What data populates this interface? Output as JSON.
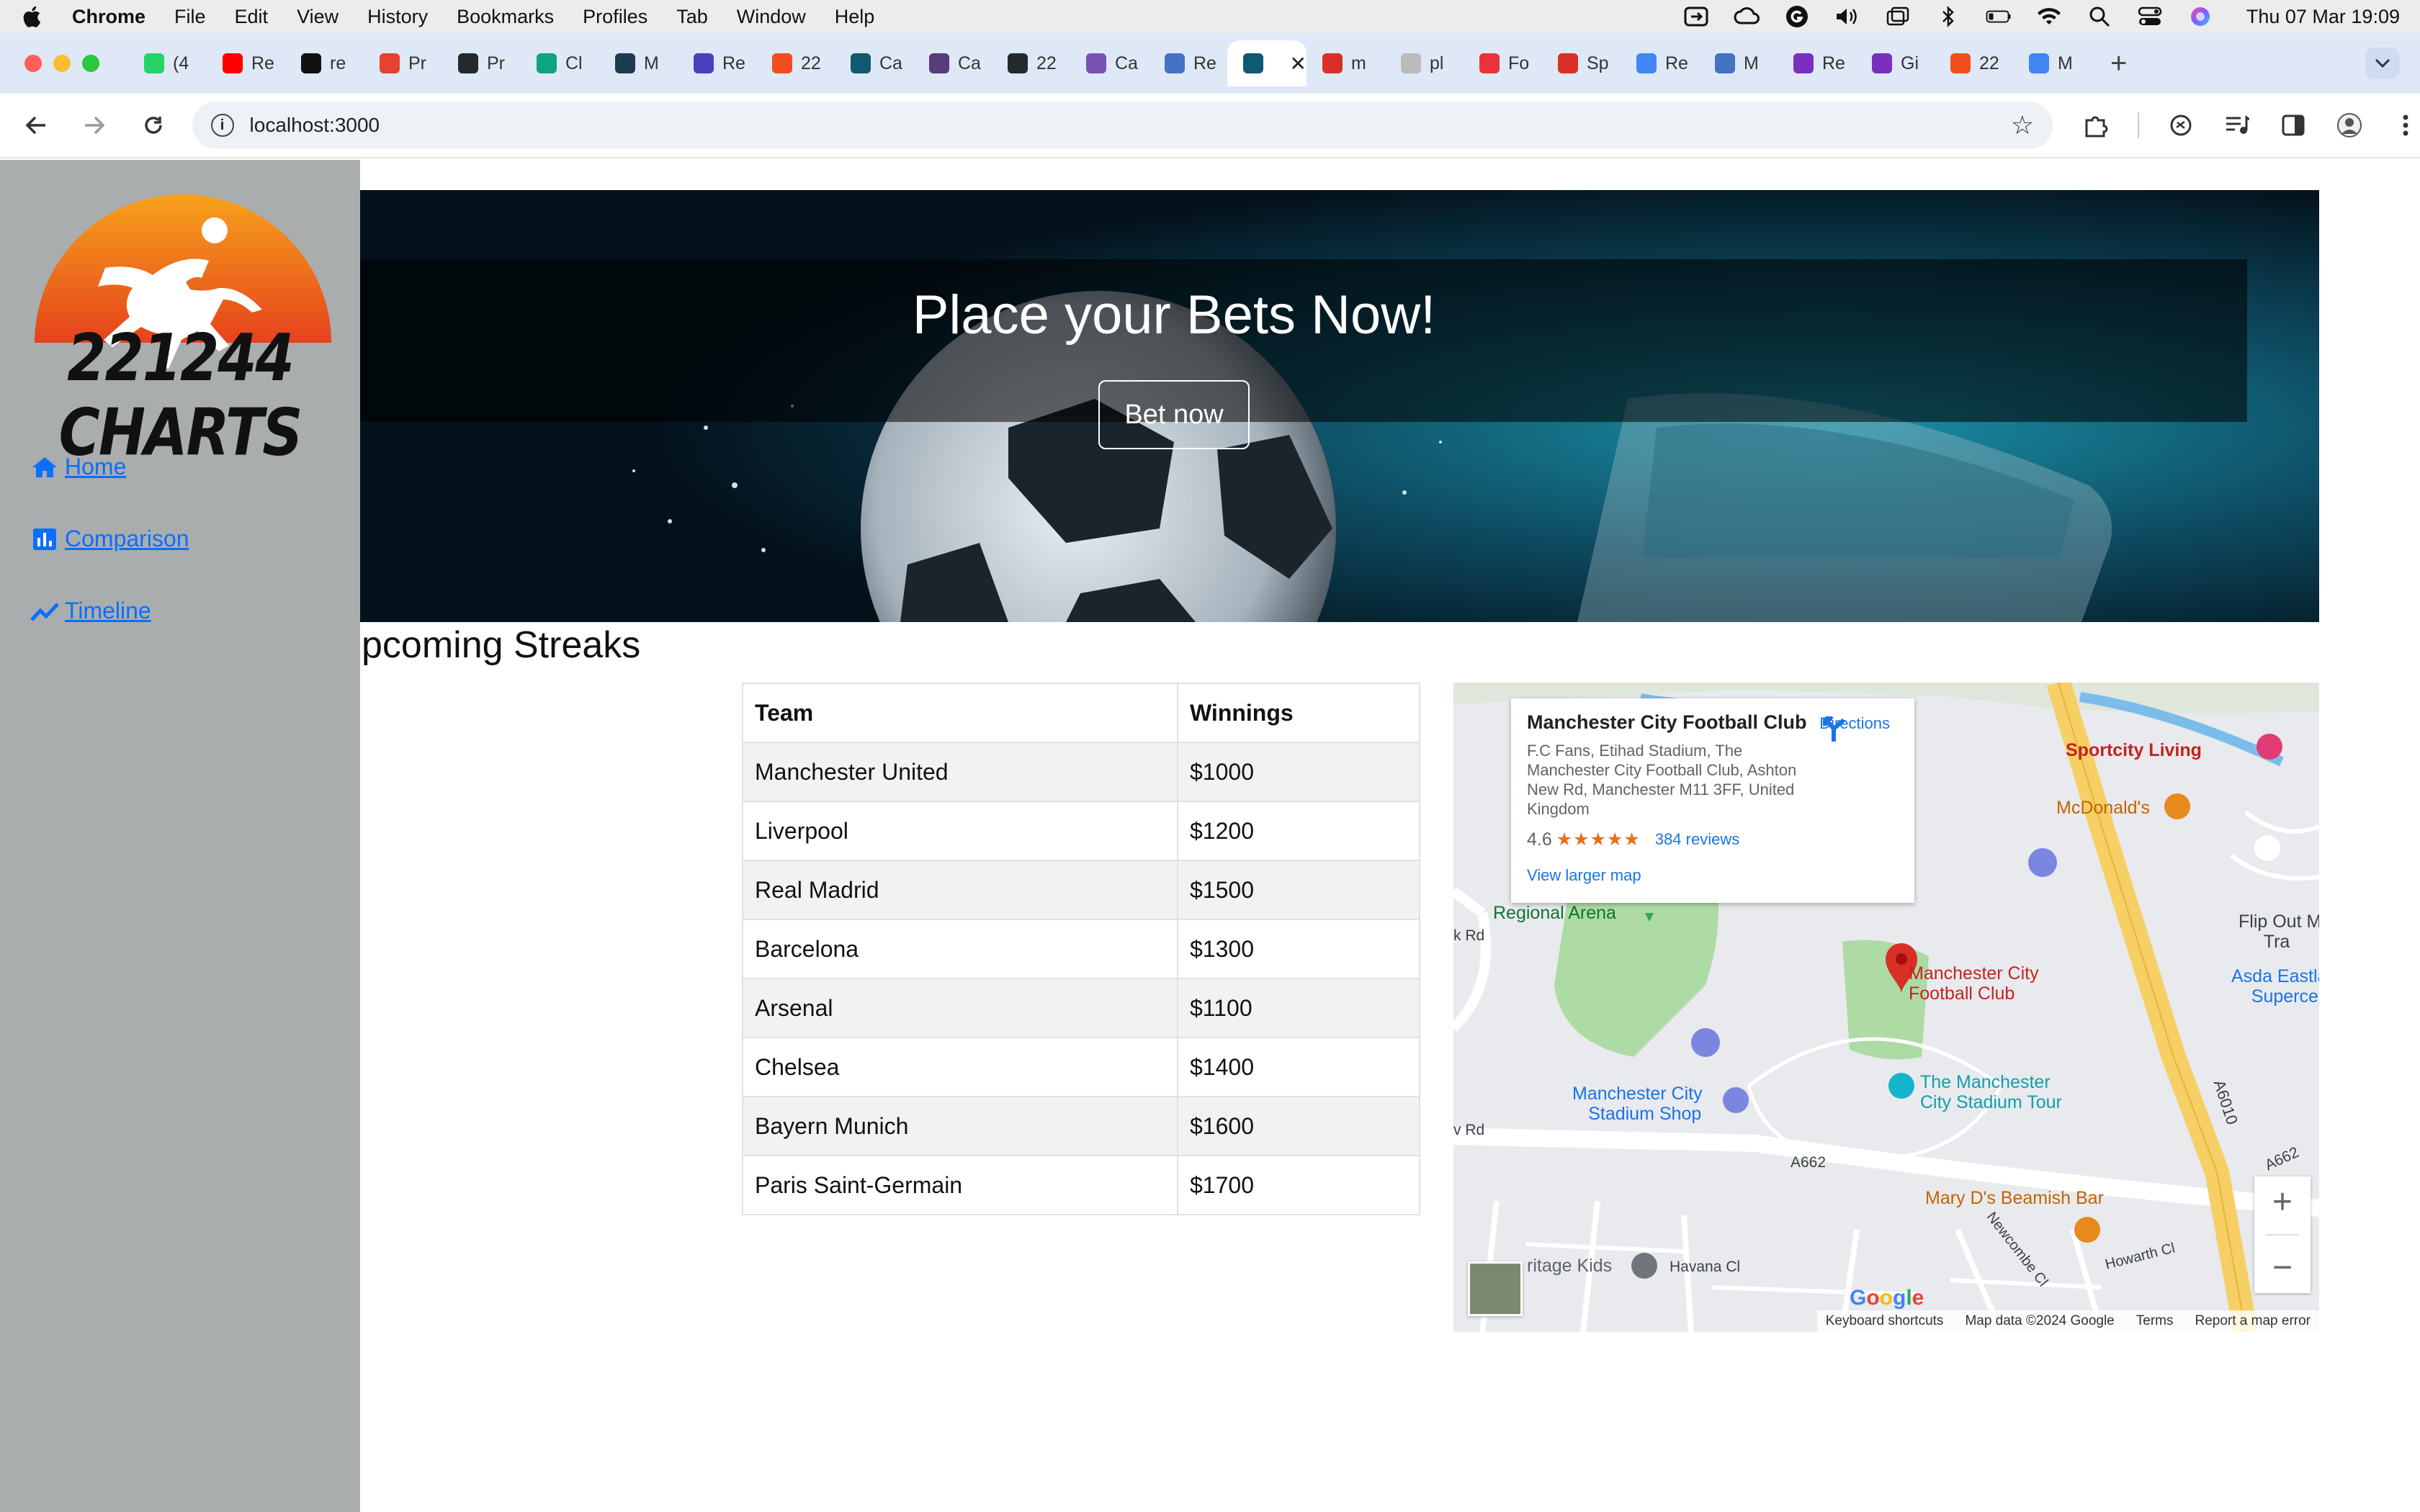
{
  "os_menubar": {
    "app_name": "Chrome",
    "menus": [
      "File",
      "Edit",
      "View",
      "History",
      "Bookmarks",
      "Profiles",
      "Tab",
      "Window",
      "Help"
    ],
    "clock": "Thu 07 Mar  19:09"
  },
  "browser": {
    "tabs": [
      {
        "label": "(4",
        "color": "#25d366"
      },
      {
        "label": "Re",
        "color": "#ff0000"
      },
      {
        "label": "re",
        "color": "#111111"
      },
      {
        "label": "Pr",
        "color": "#e44332"
      },
      {
        "label": "Pr",
        "color": "#24292f"
      },
      {
        "label": "Cl",
        "color": "#10a37f"
      },
      {
        "label": "M",
        "color": "#1d3b4f"
      },
      {
        "label": "Re",
        "color": "#4b3fbf"
      },
      {
        "label": "22",
        "color": "#f24e1e"
      },
      {
        "label": "Ca",
        "color": "#0e5a6e"
      },
      {
        "label": "Ca",
        "color": "#563d7c"
      },
      {
        "label": "22",
        "color": "#24292f"
      },
      {
        "label": "Ca",
        "color": "#7952b3"
      },
      {
        "label": "Re",
        "color": "#4472c4"
      },
      {
        "label": "",
        "color": "#0e5a6e",
        "active": true
      },
      {
        "label": "m",
        "color": "#d93025"
      },
      {
        "label": "pl",
        "color": "#bbbbbb"
      },
      {
        "label": "Fo",
        "color": "#e8323c"
      },
      {
        "label": "Sp",
        "color": "#d93025"
      },
      {
        "label": "Re",
        "color": "#4285f4"
      },
      {
        "label": "M",
        "color": "#4472c4"
      },
      {
        "label": "Re",
        "color": "#7b2fbe"
      },
      {
        "label": "Gi",
        "color": "#7b2fbe"
      },
      {
        "label": "22",
        "color": "#f24e1e"
      },
      {
        "label": "M",
        "color": "#4285f4"
      }
    ],
    "url": "localhost:3000"
  },
  "sidebar": {
    "logo_text": "221244 CHARTS",
    "nav": [
      {
        "label": "Home",
        "icon": "home-icon"
      },
      {
        "label": "Comparison",
        "icon": "bar-chart-icon"
      },
      {
        "label": "Timeline",
        "icon": "trend-line-icon"
      }
    ]
  },
  "hero": {
    "title": "Place your Bets Now!",
    "button_label": "Bet now"
  },
  "section_title": "pcoming Streaks",
  "table": {
    "headers": [
      "Team",
      "Winnings"
    ],
    "rows": [
      [
        "Manchester United",
        "$1000"
      ],
      [
        "Liverpool",
        "$1200"
      ],
      [
        "Real Madrid",
        "$1500"
      ],
      [
        "Barcelona",
        "$1300"
      ],
      [
        "Arsenal",
        "$1100"
      ],
      [
        "Chelsea",
        "$1400"
      ],
      [
        "Bayern Munich",
        "$1600"
      ],
      [
        "Paris Saint-Germain",
        "$1700"
      ]
    ]
  },
  "map": {
    "place_title": "Manchester City Football Club",
    "address": "F.C Fans, Etihad Stadium, The Manchester City Football Club, Ashton New Rd, Manchester M11 3FF, United Kingdom",
    "rating": "4.6",
    "reviews": "384 reviews",
    "view_larger": "View larger map",
    "directions": "Directions",
    "labels": {
      "sportcity": "Sportcity Living",
      "mcdonalds": "McDonald's",
      "regional_arena": "Regional Arena",
      "club_marker_line1": "Manchester City",
      "club_marker_line2": "Football Club",
      "flipout": "Flip Out M",
      "flipout2": "Tra",
      "asda": "Asda Eastla",
      "asda2": "Superce",
      "stadium_shop_line1": "Manchester City",
      "stadium_shop_line2": "Stadium Shop",
      "tour_line1": "The Manchester",
      "tour_line2": "City Stadium Tour",
      "a662": "A662",
      "a662b": "A662",
      "a6010": "A6010",
      "marys": "Mary D's Beamish Bar",
      "heritage": "ritage Kids",
      "havana": "Havana Cl",
      "newcombe": "Newcombe Cl",
      "howarth": "Howarth Cl",
      "rd_left": "k Rd",
      "rd_left2": "v Rd"
    },
    "footer": [
      "Keyboard shortcuts",
      "Map data ©2024 Google",
      "Terms",
      "Report a map error"
    ],
    "google_letters": [
      "G",
      "o",
      "o",
      "g",
      "l",
      "e"
    ]
  }
}
